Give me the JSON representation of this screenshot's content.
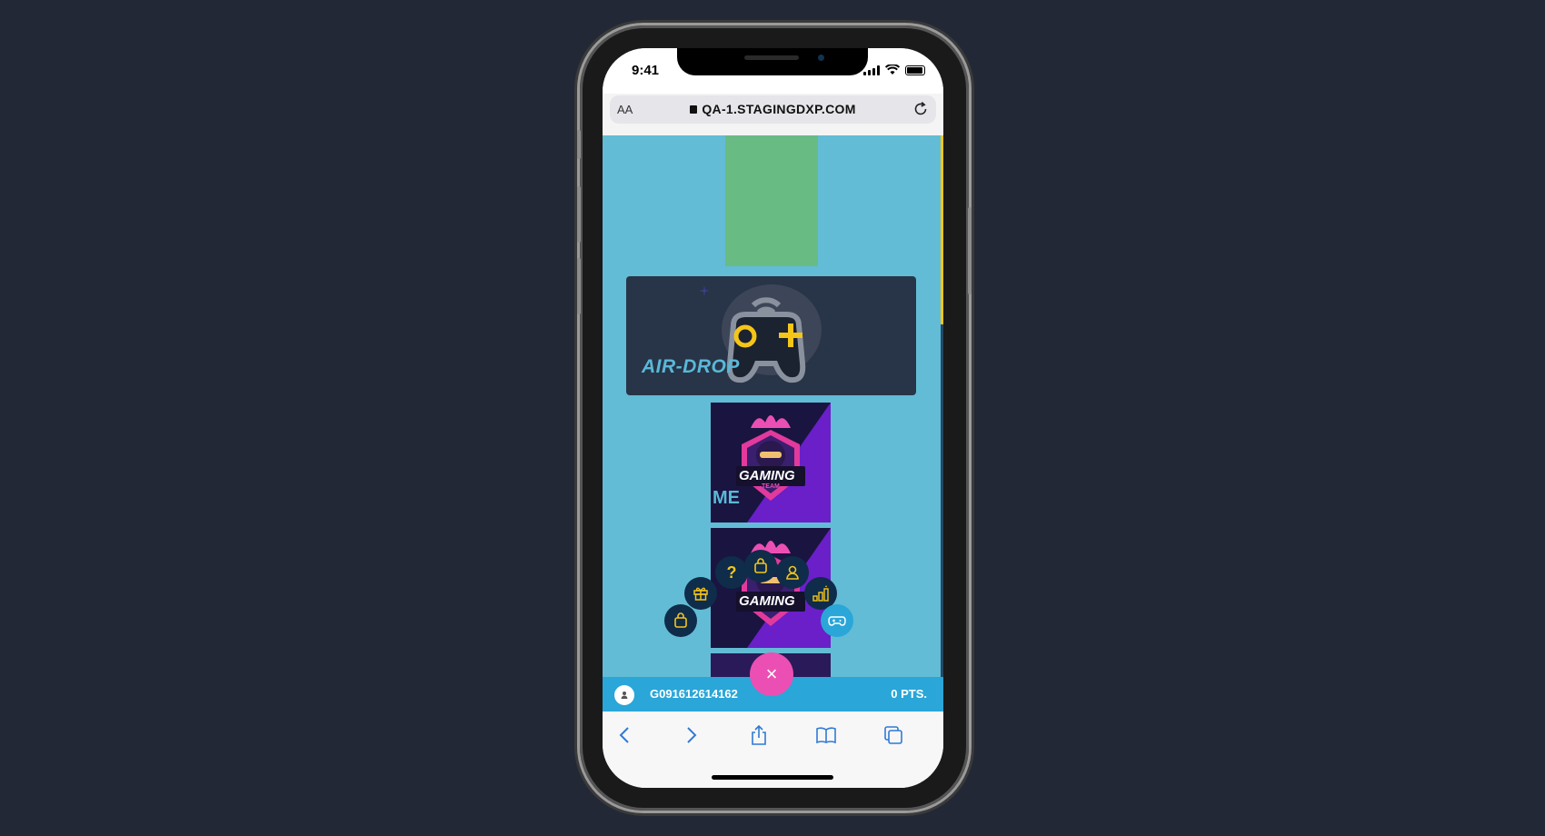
{
  "status_bar": {
    "time": "9:41"
  },
  "browser": {
    "text_size_label": "AA",
    "url": "QA-1.STAGINGDXP.COM"
  },
  "content": {
    "banner_label": "AIR-DROP",
    "tile_1": {
      "logo_text": "GAMING",
      "logo_subtext": "TEAM",
      "overlay_text": "ME"
    },
    "tile_2": {
      "logo_text": "GAMING",
      "logo_subtext": "TEAM"
    }
  },
  "quick_menu": {
    "icons": [
      "bag-icon",
      "gift-icon",
      "help-icon",
      "shop-icon",
      "user-icon",
      "leaderboard-icon",
      "gamepad-icon"
    ],
    "close_label": "×"
  },
  "user_bar": {
    "user_id": "G091612614162",
    "points": "0 PTS."
  },
  "colors": {
    "page_background": "#62bcd5",
    "accent_pink": "#ec4fb3",
    "accent_yellow": "#f5c518",
    "user_bar": "#2aa6d8"
  }
}
